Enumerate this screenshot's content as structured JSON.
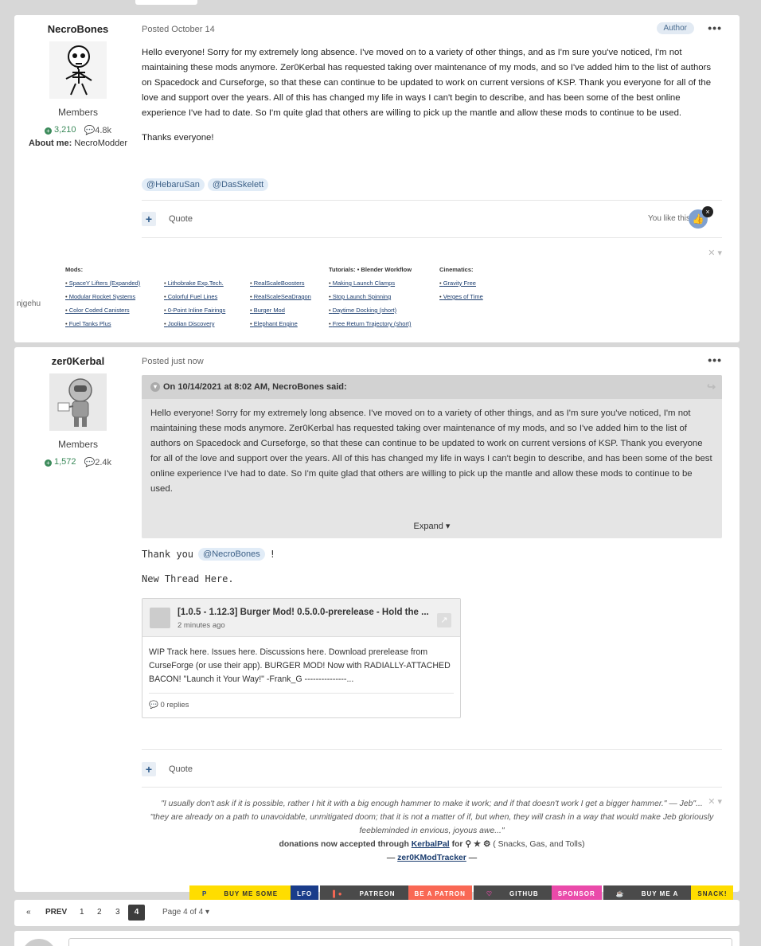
{
  "post1": {
    "author": "NecroBones",
    "group": "Members",
    "reputation": "3,210",
    "posts": "4.8k",
    "about_label": "About me:",
    "about_value": "NecroModder",
    "posted": "Posted October 14",
    "author_badge": "Author",
    "more": "•••",
    "paragraph1": "Hello everyone! Sorry for my extremely long absence. I've moved on to a variety of other things, and as I'm sure you've noticed, I'm not maintaining these mods anymore. Zer0Kerbal has requested taking over maintenance of my mods, and so I've added him to the list of authors on Spacedock and Curseforge, so that these can continue to be updated to work on current versions of KSP. Thank you everyone for all of the love and support over the years. All of this has changed my life in ways I can't begin to describe, and has been some of the best online experience I've had to date. So I'm quite glad that others are willing to pick up the mantle and allow these mods to continue to be used.",
    "paragraph2": "Thanks everyone!",
    "mentions": [
      "@HebaruSan",
      "@DasSkelett"
    ],
    "quote_label": "Quote",
    "like_text": "You like this",
    "signature": {
      "image_alt": "njgehu",
      "columns": [
        {
          "header": "Mods:",
          "items": [
            "SpaceY Lifters (Expanded)",
            "Modular Rocket Systems",
            "Color Coded Canisters",
            "Fuel Tanks Plus"
          ]
        },
        {
          "header": "",
          "items": [
            "Lithobrake Exp.Tech.",
            "Colorful Fuel Lines",
            "0-Point Inline Fairings",
            "Joolian Discovery"
          ]
        },
        {
          "header": "",
          "items": [
            "RealScaleBoosters",
            "RealScaleSeaDragon",
            "Burger Mod",
            "Elephant Engine"
          ]
        },
        {
          "header": "Tutorials: • Blender Workflow",
          "items": [
            "Making Launch Clamps",
            "Stop Launch Spinning",
            "Daytime Docking (short)",
            "Free Return Trajectory (short)"
          ]
        },
        {
          "header": "Cinematics:",
          "items": [
            "Gravity Free",
            "Verges of Time"
          ]
        }
      ]
    }
  },
  "post2": {
    "author": "zer0Kerbal",
    "group": "Members",
    "reputation": "1,572",
    "posts": "2.4k",
    "posted": "Posted just now",
    "more": "•••",
    "quote_header": "On 10/14/2021 at 8:02 AM, NecroBones said:",
    "quote_text": "Hello everyone! Sorry for my extremely long absence. I've moved on to a variety of other things, and as I'm sure you've noticed, I'm not maintaining these mods anymore. Zer0Kerbal has requested taking over maintenance of my mods, and so I've added him to the list of authors on Spacedock and Curseforge, so that these can continue to be updated to work on current versions of KSP. Thank you everyone for all of the love and support over the years. All of this has changed my life in ways I can't begin to describe, and has been some of the best online experience I've had to date. So I'm quite glad that others are willing to pick up the mantle and allow these mods to continue to be used.",
    "expand_label": "Expand",
    "thank_prefix": "Thank you",
    "thank_mention": "@NecroBones",
    "thank_suffix": "!",
    "new_thread": "New Thread Here.",
    "embed": {
      "title": "[1.0.5 - 1.12.3] Burger Mod! 0.5.0.0-prerelease - Hold the ...",
      "time": "2 minutes ago",
      "body": "WIP Track here. Issues here. Discussions here. Download prerelease from CurseForge (or use their app).   BURGER MOD! Now with RADIALLY-ATTACHED BACON! \"Launch it Your Way!\" -Frank_G ---------------...",
      "replies": "0 replies"
    },
    "quote_label": "Quote",
    "sig_quote1": "\"I usually don't ask if it is possible, rather I hit it with a big enough hammer to make it work; and if that doesn't work I get a bigger hammer.\"  — Jeb\"...",
    "sig_quote2": "\"they are already on a path to unavoidable, unmitigated doom; that it is not a matter of if, but when, they will crash in a way that would make Jeb gloriously feebleminded in envious, joyous awe...\"",
    "sig_donate_prefix": "donations now accepted through",
    "sig_donate_link": "KerbalPal",
    "sig_donate_for": "for",
    "sig_donate_suffix": "( Snacks, Gas, and Tolls)",
    "sig_tracker": "zer0KModTracker",
    "donate_buttons": [
      {
        "label": "BUY ME SOME",
        "bg": "#ffdd00",
        "fg": "#333"
      },
      {
        "label": "LFO",
        "bg": "#1a3c8a",
        "fg": "#fff"
      },
      {
        "label": "PATREON",
        "bg": "#4a4a4a",
        "fg": "#fff"
      },
      {
        "label": "BE A PATRON",
        "bg": "#f96854",
        "fg": "#fff"
      },
      {
        "label": "GITHUB",
        "bg": "#4a4a4a",
        "fg": "#fff"
      },
      {
        "label": "SPONSOR",
        "bg": "#ea4aaa",
        "fg": "#fff"
      },
      {
        "label": "BUY ME A",
        "bg": "#4a4a4a",
        "fg": "#fff"
      },
      {
        "label": "SNACK!",
        "bg": "#ffdd00",
        "fg": "#333"
      }
    ]
  },
  "pagination": {
    "prev_icon": "«",
    "prev": "PREV",
    "pages": [
      "1",
      "2",
      "3"
    ],
    "current": "4",
    "page_of": "Page 4 of 4"
  }
}
